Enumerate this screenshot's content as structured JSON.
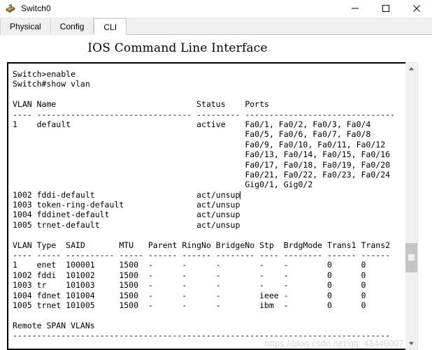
{
  "window": {
    "title": "Switch0",
    "icon": "switch-device-icon",
    "controls": {
      "minimize": "—",
      "maximize": "□",
      "close": "✕"
    }
  },
  "tabs": [
    {
      "label": "Physical",
      "active": false
    },
    {
      "label": "Config",
      "active": false
    },
    {
      "label": "CLI",
      "active": true
    }
  ],
  "heading": "IOS Command Line Interface",
  "terminal": {
    "lines": [
      "Switch>enable",
      "Switch#show vlan",
      "",
      "VLAN Name                             Status    Ports",
      "---- -------------------------------- --------- -------------------------------",
      "1    default                          active    Fa0/1, Fa0/2, Fa0/3, Fa0/4",
      "                                                Fa0/5, Fa0/6, Fa0/7, Fa0/8",
      "                                                Fa0/9, Fa0/10, Fa0/11, Fa0/12",
      "                                                Fa0/13, Fa0/14, Fa0/15, Fa0/16",
      "                                                Fa0/17, Fa0/18, Fa0/19, Fa0/20",
      "                                                Fa0/21, Fa0/22, Fa0/23, Fa0/24",
      "                                                Gig0/1, Gig0/2",
      "1002 fddi-default                     act/unsup",
      "1003 token-ring-default               act/unsup",
      "1004 fddinet-default                  act/unsup",
      "1005 trnet-default                    act/unsup",
      "",
      "VLAN Type  SAID       MTU   Parent RingNo BridgeNo Stp  BrdgMode Trans1 Trans2",
      "---- ----- ---------- ----- ------ ------ -------- ---- -------- ------ ------",
      "1    enet  100001     1500  -      -      -        -    -        0      0",
      "1002 fddi  101002     1500  -      -      -        -    -        0      0",
      "1003 tr    101003     1500  -      -      -        -    -        0      0",
      "1004 fdnet 101004     1500  -      -      -        ieee -        0      0",
      "1005 trnet 101005     1500  -      -      -        ibm  -        0      0",
      "",
      "Remote SPAN VLANs",
      "------------------------------------------------------------------------------"
    ],
    "caret_line_index": 12,
    "caret_column": 49
  },
  "scrollbar": {
    "up_arrow": "▲",
    "down_arrow": "▼",
    "thumb_position_percent": 64
  },
  "watermark": "https://blog.csdn.net/qq_43446007",
  "colors": {
    "tab_bar_background": "#efefef",
    "active_tab_background": "#ffffff",
    "terminal_background": "#ffffff",
    "terminal_text": "#000000",
    "terminal_border": "#000000",
    "scrollbar_track": "#f0f0f0",
    "scrollbar_thumb": "#c5c5c5",
    "watermark_text": "#d8d8d8"
  }
}
